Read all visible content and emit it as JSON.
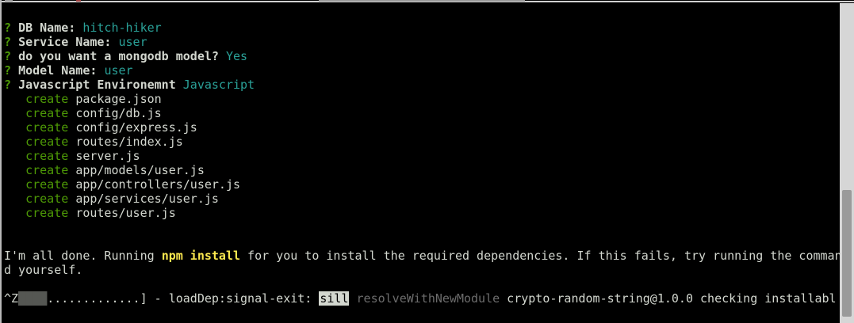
{
  "prompts": [
    {
      "q": "?",
      "label": "DB Name:",
      "value": "hitch-hiker"
    },
    {
      "q": "?",
      "label": "Service Name:",
      "value": "user"
    },
    {
      "q": "?",
      "label": "do you want a mongodb model?",
      "value": "Yes"
    },
    {
      "q": "?",
      "label": "Model Name:",
      "value": "user"
    },
    {
      "q": "?",
      "label": "Javascript Environemnt",
      "value": "Javascript"
    }
  ],
  "create_label": "create",
  "created_files": [
    "package.json",
    "config/db.js",
    "config/express.js",
    "routes/index.js",
    "server.js",
    "app/models/user.js",
    "app/controllers/user.js",
    "app/services/user.js",
    "routes/user.js"
  ],
  "message": {
    "line1_pre": "I'm all done. Running ",
    "line1_cmd": "npm install",
    "line1_post": " for you to install the required dependencies. If this fails, try running the comman",
    "line2": "d yourself."
  },
  "progress": {
    "ctrl": "^Z",
    "blocks": "████",
    "dots": ".............] - loadDep:signal-exit: ",
    "level": "sill",
    "action": "resolveWithNewModule",
    "rest": " crypto-random-string@1.0.0 checking installabl"
  },
  "colors": {
    "background": "#000000",
    "prompt_q": "#4e9a06",
    "value": "#2aa198",
    "create": "#4e9a06",
    "command_highlight": "#fce94f"
  }
}
